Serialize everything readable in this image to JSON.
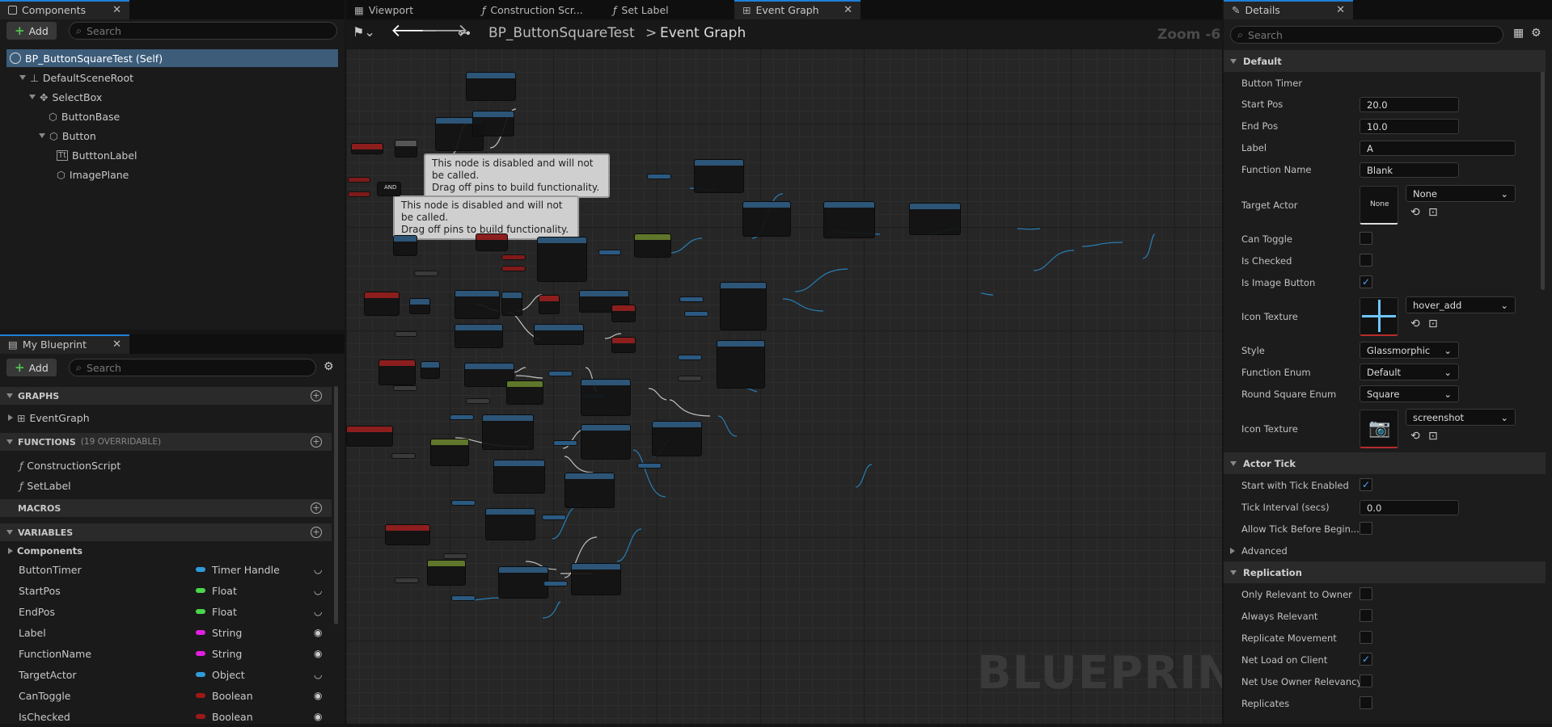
{
  "components_panel": {
    "tab_label": "Components",
    "add_label": "Add",
    "search_placeholder": "Search",
    "tree": [
      {
        "label": "BP_ButtonSquareTest (Self)"
      },
      {
        "label": "DefaultSceneRoot"
      },
      {
        "label": "SelectBox"
      },
      {
        "label": "ButtonBase"
      },
      {
        "label": "Button"
      },
      {
        "label": "ButttonLabel"
      },
      {
        "label": "ImagePlane"
      }
    ]
  },
  "my_blueprint": {
    "tab_label": "My Blueprint",
    "add_label": "Add",
    "search_placeholder": "Search",
    "graphs_label": "GRAPHS",
    "graphs": [
      "EventGraph"
    ],
    "functions_label": "FUNCTIONS",
    "functions_note": "(19 OVERRIDABLE)",
    "functions": [
      "ConstructionScript",
      "SetLabel"
    ],
    "macros_label": "MACROS",
    "variables_label": "VARIABLES",
    "components_label": "Components",
    "variables": [
      {
        "name": "ButtonTimer",
        "type": "Timer Handle",
        "color": "#2e9bdb"
      },
      {
        "name": "StartPos",
        "type": "Float",
        "color": "#4bd64b"
      },
      {
        "name": "EndPos",
        "type": "Float",
        "color": "#4bd64b"
      },
      {
        "name": "Label",
        "type": "String",
        "color": "#e21ee0"
      },
      {
        "name": "FunctionName",
        "type": "String",
        "color": "#e21ee0"
      },
      {
        "name": "TargetActor",
        "type": "Object",
        "color": "#2e9bdb"
      },
      {
        "name": "CanToggle",
        "type": "Boolean",
        "color": "#a01818"
      },
      {
        "name": "IsChecked",
        "type": "Boolean",
        "color": "#a01818"
      }
    ]
  },
  "editor_tabs": [
    {
      "label": "Viewport"
    },
    {
      "label": "Construction Scr..."
    },
    {
      "label": "Set Label"
    },
    {
      "label": "Event Graph"
    }
  ],
  "graph": {
    "breadcrumb_root": "BP_ButtonSquareTest",
    "breadcrumb_sep": ">",
    "breadcrumb_current": "Event Graph",
    "zoom": "Zoom -6",
    "watermark": "BLUEPRINT",
    "comment_1_line1": "This node is disabled and will not be called.",
    "comment_1_line2": "Drag off pins to build functionality.",
    "comment_2_line1": "This node is disabled and will not be called.",
    "comment_2_line2": "Drag off pins to build functionality.",
    "node_and_label": "AND"
  },
  "details": {
    "tab_label": "Details",
    "search_placeholder": "Search",
    "section_default": "Default",
    "button_timer": "Button Timer",
    "start_pos_label": "Start Pos",
    "start_pos": "20.0",
    "end_pos_label": "End Pos",
    "end_pos": "10.0",
    "label_label": "Label",
    "label": "A",
    "function_name_label": "Function Name",
    "function_name": "Blank",
    "target_actor_label": "Target Actor",
    "target_actor_thumb": "None",
    "target_actor": "None",
    "can_toggle_label": "Can Toggle",
    "is_checked_label": "Is Checked",
    "is_image_button_label": "Is Image Button",
    "icon_texture_label": "Icon Texture",
    "icon_texture": "hover_add",
    "style_label": "Style",
    "style": "Glassmorphic",
    "function_enum_label": "Function Enum",
    "function_enum": "Default",
    "round_square_label": "Round Square Enum",
    "round_square": "Square",
    "icon_texture2_label": "Icon Texture",
    "icon_texture2": "screenshot",
    "section_actor_tick": "Actor Tick",
    "start_tick_label": "Start with Tick Enabled",
    "tick_interval_label": "Tick Interval (secs)",
    "tick_interval": "0.0",
    "allow_tick_label": "Allow Tick Before Begin...",
    "advanced_label": "Advanced",
    "section_replication": "Replication",
    "only_relevant_label": "Only Relevant to Owner",
    "always_relevant_label": "Always Relevant",
    "replicate_movement_label": "Replicate Movement",
    "net_load_label": "Net Load on Client",
    "net_use_owner_label": "Net Use Owner Relevancy",
    "replicates_label": "Replicates"
  }
}
